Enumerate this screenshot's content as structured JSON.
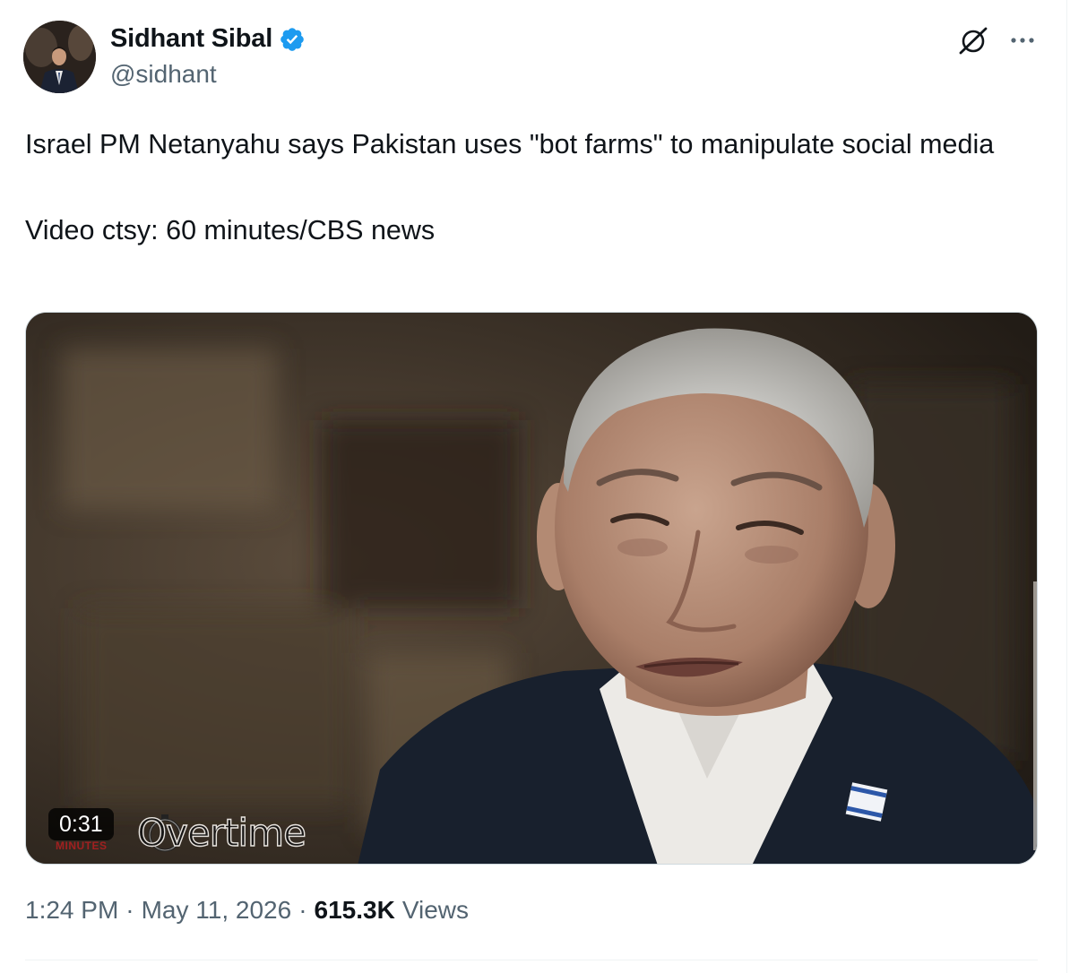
{
  "author": {
    "display_name": "Sidhant Sibal",
    "handle": "@sidhant",
    "verified": true,
    "avatar_icon": "profile-photo"
  },
  "header_actions": {
    "grok_icon": "grok-icon",
    "more_icon": "more-dots-icon"
  },
  "tweet": {
    "text_line1": "Israel PM Netanyahu says Pakistan uses \"bot farms\" to manipulate social media",
    "text_line2": "Video ctsy: 60 minutes/CBS news"
  },
  "media": {
    "type": "video",
    "duration": "0:31",
    "watermark": "Overtime",
    "watermark_sub": "MINUTES"
  },
  "meta": {
    "time": "1:24 PM",
    "separator": "·",
    "date": "May 11, 2026",
    "views_count": "615.3K",
    "views_label": "Views"
  },
  "colors": {
    "text_primary": "#0f1419",
    "text_secondary": "#536471",
    "verified_blue": "#1d9bf0",
    "divider": "#eff3f4"
  }
}
